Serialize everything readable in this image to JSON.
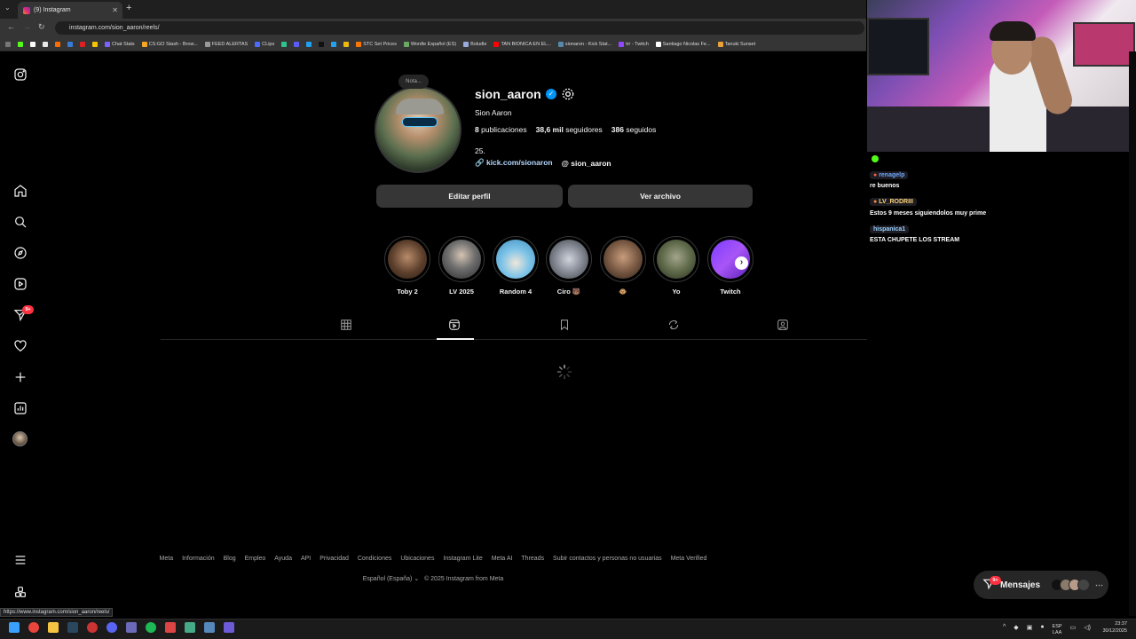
{
  "browser": {
    "tab_title": "(9) Instagram",
    "new_tab": "+",
    "url": "instagram.com/sion_aaron/reels/",
    "status_url": "https://www.instagram.com/sion_aaron/reels/",
    "bookmarks": [
      "Chat Stats",
      "CS:GO Stash - Brow...",
      "FEED ALERTAS",
      "CLips",
      "STC Set Prices",
      "Wordle Español (ES)",
      "Boludle",
      "TAN BIONICA EN EL...",
      "sionaron - Kick Stat...",
      "trr - Twitch",
      "Santiago Nicolas Fe...",
      "Tanuki Sunset"
    ]
  },
  "sidebar": {
    "notif_badge": "9+"
  },
  "profile": {
    "note": "Nota...",
    "username": "sion_aaron",
    "verified": "✓",
    "fullname": "Sion Aaron",
    "posts_count": "8",
    "posts_label": "publicaciones",
    "followers_count": "38,6 mil",
    "followers_label": "seguidores",
    "following_count": "386",
    "following_label": "seguidos",
    "bio": "25.",
    "link": "kick.com/sionaron",
    "threads": "sion_aaron",
    "edit_btn": "Editar perfil",
    "archive_btn": "Ver archivo"
  },
  "highlights": [
    {
      "label": "Toby 2"
    },
    {
      "label": "LV 2025"
    },
    {
      "label": "Random 4"
    },
    {
      "label": "Ciro 🐻"
    },
    {
      "label": "🐵"
    },
    {
      "label": "Yo"
    },
    {
      "label": "Twitch"
    }
  ],
  "footer": {
    "links": [
      "Meta",
      "Información",
      "Blog",
      "Empleo",
      "Ayuda",
      "API",
      "Privacidad",
      "Condiciones",
      "Ubicaciones",
      "Instagram Lite",
      "Meta AI",
      "Threads",
      "Subir contactos y personas no usuarias",
      "Meta Verified"
    ],
    "language": "Español (España)",
    "copyright": "© 2025 Instagram from Meta"
  },
  "messages": {
    "label": "Mensajes",
    "badge": "9+"
  },
  "chat": [
    {
      "user": "renagelp",
      "msg": "re buenos",
      "color": "#6fa8ff"
    },
    {
      "user": "LV_RODRIII",
      "msg": "Estos 9 meses siguiendolos muy prime",
      "color": "#ffd27a"
    },
    {
      "user": "hispanica1",
      "msg": "ESTA CHUPETE LOS STREAM",
      "color": "#9bd1ff"
    }
  ],
  "tray": {
    "lang": "ESP",
    "lang2": "LAA",
    "time": "23:37",
    "date": "30/12/2025"
  },
  "colors": {
    "accent_blue": "#0095f6",
    "badge_red": "#ff3040"
  }
}
